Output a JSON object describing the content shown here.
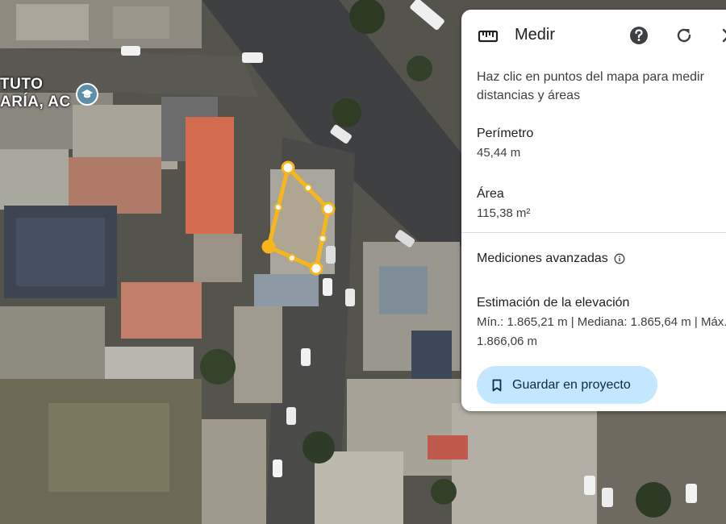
{
  "map": {
    "poi_label_line1": "TUTO",
    "poi_label_line2": "ARÍA, AC",
    "poi_icon": "school-icon"
  },
  "panel": {
    "title": "Medir",
    "ruler_icon": "ruler-icon",
    "help_icon": "help-icon",
    "reset_icon": "refresh-icon",
    "instruction": "Haz clic en puntos del mapa para medir distancias y áreas",
    "perimeter_label": "Perímetro",
    "perimeter_value": "45,44 m",
    "area_label": "Área",
    "area_value": "115,38 m²",
    "advanced_label": "Mediciones avanzadas",
    "elevation_label": "Estimación de la elevación",
    "elevation_value": "Mín.: 1.865,21 m | Mediana: 1.865,64 m | Máx.: 1.866,06 m",
    "save_label": "Guardar en proyecto",
    "save_icon": "bookmark-icon"
  },
  "colors": {
    "measure_line": "#f9b61b",
    "accent_button": "#c2e7ff"
  }
}
